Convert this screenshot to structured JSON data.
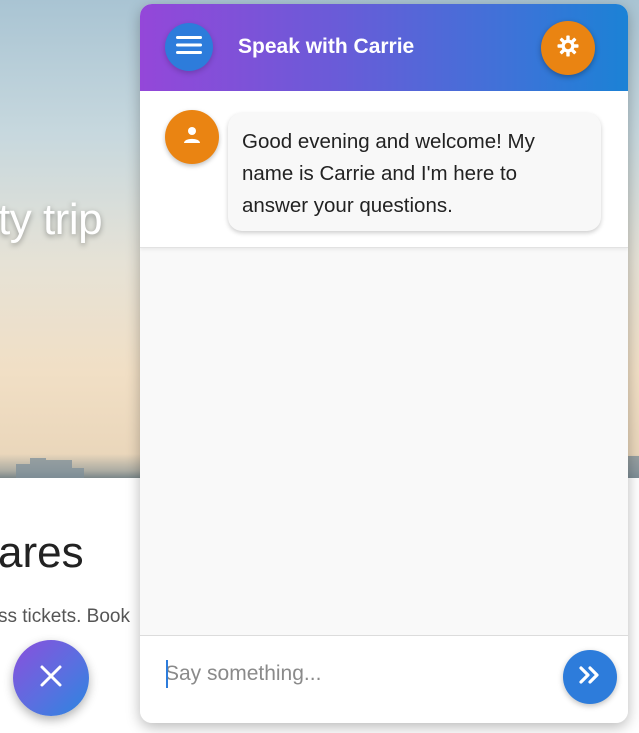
{
  "background_page": {
    "hero_text": "ty trip",
    "heading": "ares",
    "body_text": "ss tickets. Book"
  },
  "chat": {
    "title": "Speak with Carrie",
    "messages": [
      {
        "sender_icon": "person-icon",
        "text": "Good evening and welcome! My name is Carrie and I'm here to answer your questions."
      }
    ],
    "input": {
      "value": "",
      "placeholder": "Say something..."
    }
  },
  "icons": {
    "menu": "menu-icon",
    "settings": "gear-icon",
    "avatar": "person-icon",
    "send": "double-chevron-right-icon",
    "close": "close-icon"
  },
  "colors": {
    "header_gradient_start": "#9447d9",
    "header_gradient_end": "#1b82d6",
    "accent_blue": "#2d7cdb",
    "accent_orange": "#ea8412"
  }
}
